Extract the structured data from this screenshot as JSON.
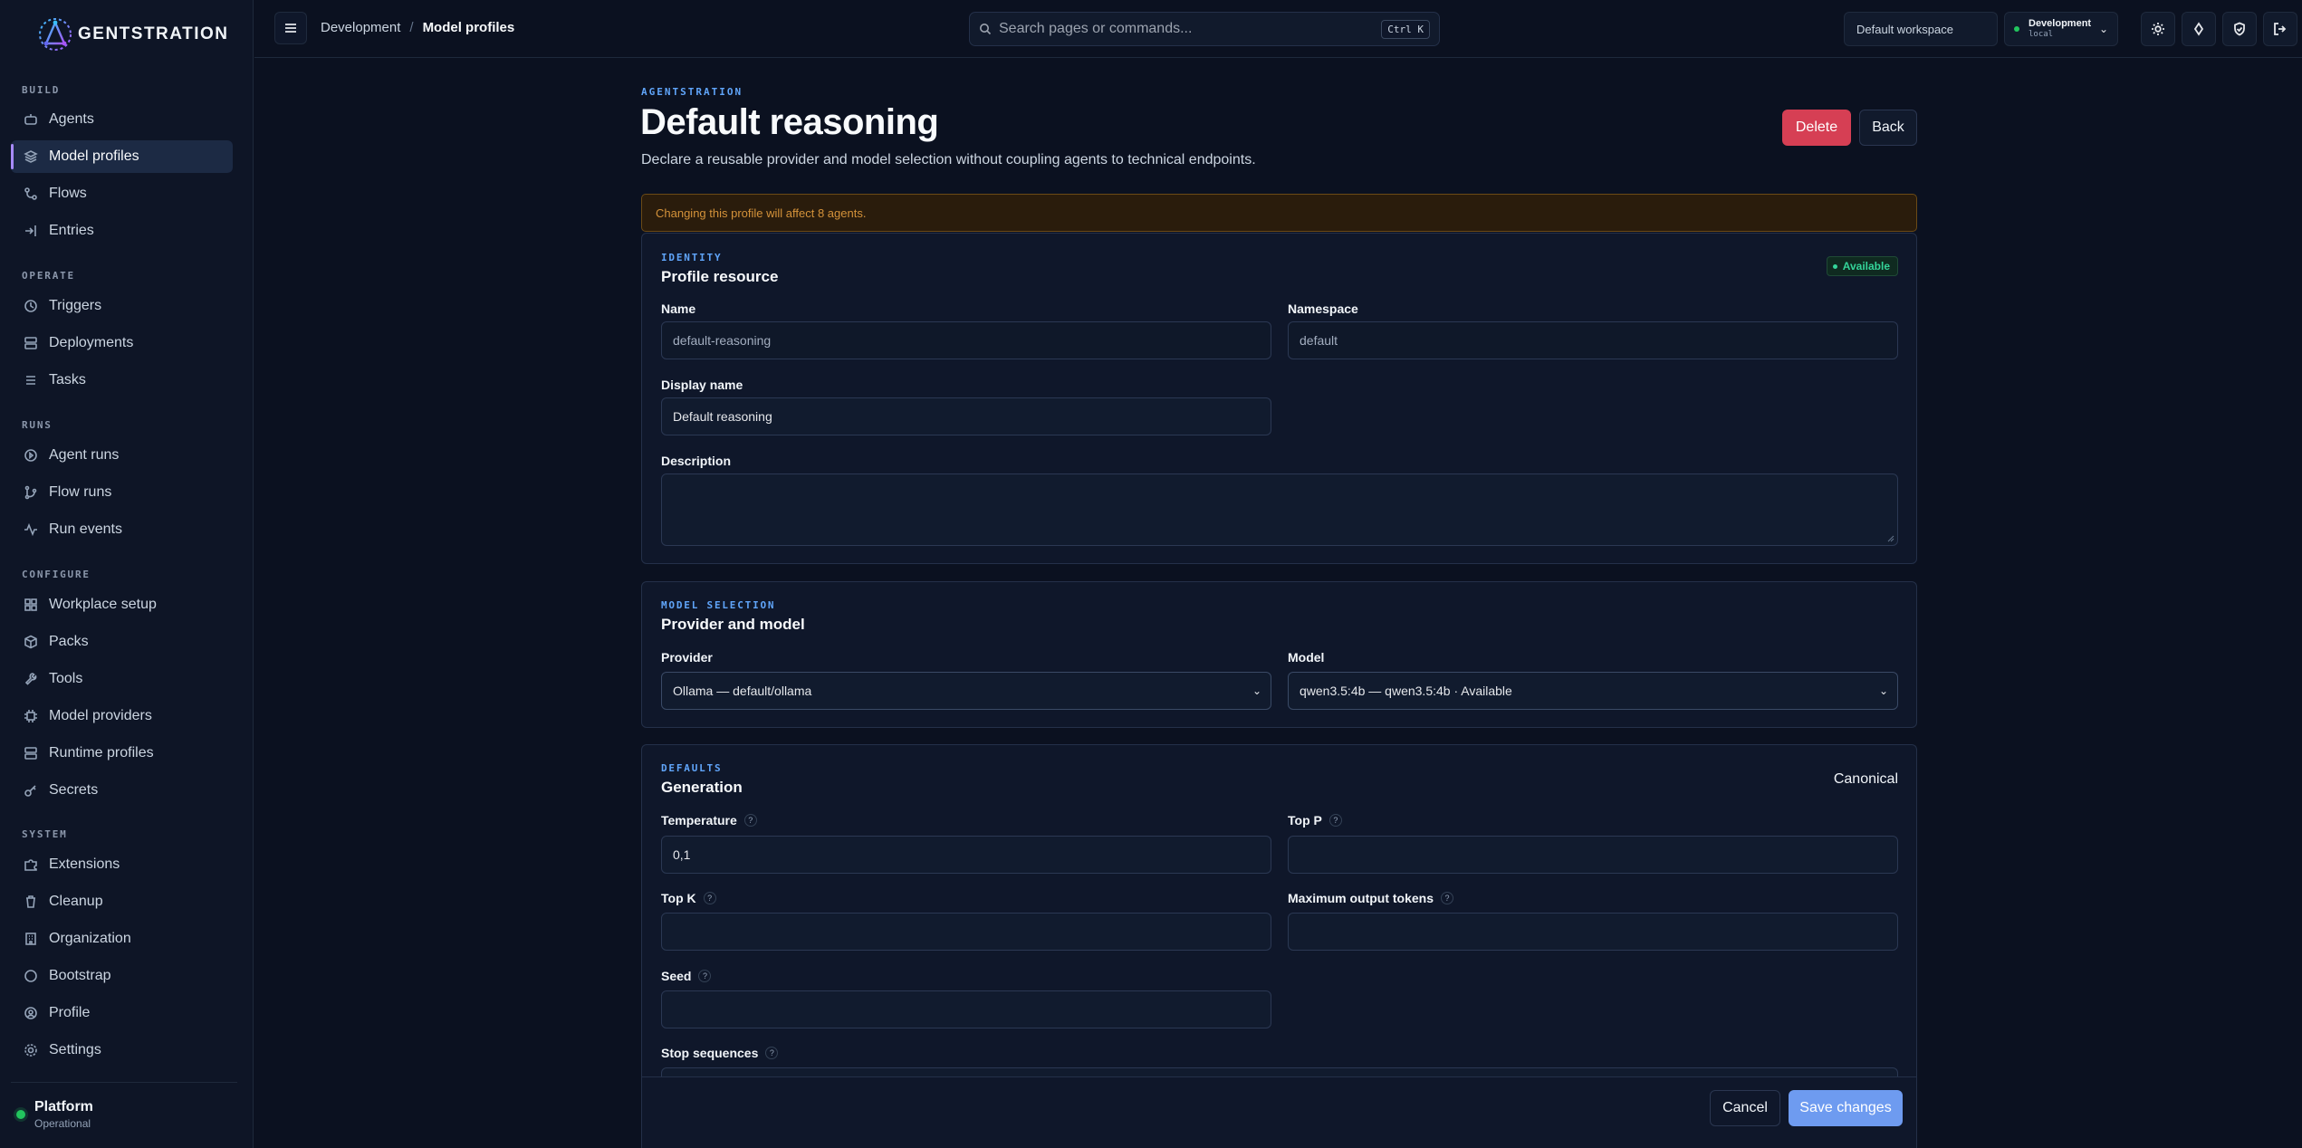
{
  "app": {
    "brand": "GENTSTRATION"
  },
  "sidebar": {
    "sections": [
      {
        "label": "BUILD"
      },
      {
        "label": "OPERATE"
      },
      {
        "label": "RUNS"
      },
      {
        "label": "CONFIGURE"
      },
      {
        "label": "SYSTEM"
      }
    ],
    "items": [
      {
        "label": "Agents",
        "icon": "robot-icon"
      },
      {
        "label": "Model profiles",
        "icon": "layers-icon",
        "active": true
      },
      {
        "label": "Flows",
        "icon": "flow-icon"
      },
      {
        "label": "Entries",
        "icon": "login-icon"
      },
      {
        "label": "Triggers",
        "icon": "clock-icon"
      },
      {
        "label": "Deployments",
        "icon": "server-icon"
      },
      {
        "label": "Tasks",
        "icon": "list-icon"
      },
      {
        "label": "Agent runs",
        "icon": "play-circle-icon"
      },
      {
        "label": "Flow runs",
        "icon": "git-branch-icon"
      },
      {
        "label": "Run events",
        "icon": "activity-icon"
      },
      {
        "label": "Workplace setup",
        "icon": "grid-icon"
      },
      {
        "label": "Packs",
        "icon": "package-icon"
      },
      {
        "label": "Tools",
        "icon": "wrench-icon"
      },
      {
        "label": "Model providers",
        "icon": "chip-icon"
      },
      {
        "label": "Runtime profiles",
        "icon": "server-icon"
      },
      {
        "label": "Secrets",
        "icon": "key-icon"
      },
      {
        "label": "Extensions",
        "icon": "puzzle-icon"
      },
      {
        "label": "Cleanup",
        "icon": "trash-icon"
      },
      {
        "label": "Organization",
        "icon": "building-icon"
      },
      {
        "label": "Bootstrap",
        "icon": "circle-icon"
      },
      {
        "label": "Profile",
        "icon": "user-circle-icon"
      },
      {
        "label": "Settings",
        "icon": "gear-icon"
      }
    ],
    "platform": {
      "name": "Platform",
      "status": "Operational",
      "status_color": "#22c55e"
    }
  },
  "topbar": {
    "breadcrumb": {
      "parent": "Development",
      "separator": "/",
      "current": "Model profiles"
    },
    "search": {
      "placeholder": "Search pages or commands...",
      "shortcut": "Ctrl K"
    },
    "workspace": "Default workspace",
    "environment": {
      "name": "Development",
      "sub": "local"
    }
  },
  "page": {
    "eyebrow": "AGENTSTRATION",
    "title": "Default reasoning",
    "subtitle": "Declare a reusable provider and model selection without coupling agents to technical endpoints.",
    "delete_label": "Delete",
    "back_label": "Back",
    "warning": "Changing this profile will affect 8 agents."
  },
  "identity": {
    "eyebrow": "IDENTITY",
    "title": "Profile resource",
    "status": "Available",
    "name_label": "Name",
    "name_value": "default-reasoning",
    "namespace_label": "Namespace",
    "namespace_value": "default",
    "display_name_label": "Display name",
    "display_name_value": "Default reasoning",
    "description_label": "Description",
    "description_value": ""
  },
  "model_selection": {
    "eyebrow": "MODEL SELECTION",
    "title": "Provider and model",
    "provider_label": "Provider",
    "provider_value": "Ollama — default/ollama",
    "model_label": "Model",
    "model_value": "qwen3.5:4b — qwen3.5:4b · Available"
  },
  "defaults": {
    "eyebrow": "DEFAULTS",
    "title": "Generation",
    "mode": "Canonical",
    "temperature_label": "Temperature",
    "temperature_value": "0,1",
    "top_p_label": "Top P",
    "top_p_value": "",
    "top_k_label": "Top K",
    "top_k_value": "",
    "max_tokens_label": "Maximum output tokens",
    "max_tokens_value": "",
    "seed_label": "Seed",
    "seed_value": "",
    "stop_label": "Stop sequences",
    "help_glyph": "?"
  },
  "footer": {
    "cancel_label": "Cancel",
    "save_label": "Save changes"
  },
  "colors": {
    "accent": "#6e9bf0",
    "danger": "#d63f54",
    "active_marker": "#a78bfa",
    "eyebrow": "#60a5fa"
  }
}
